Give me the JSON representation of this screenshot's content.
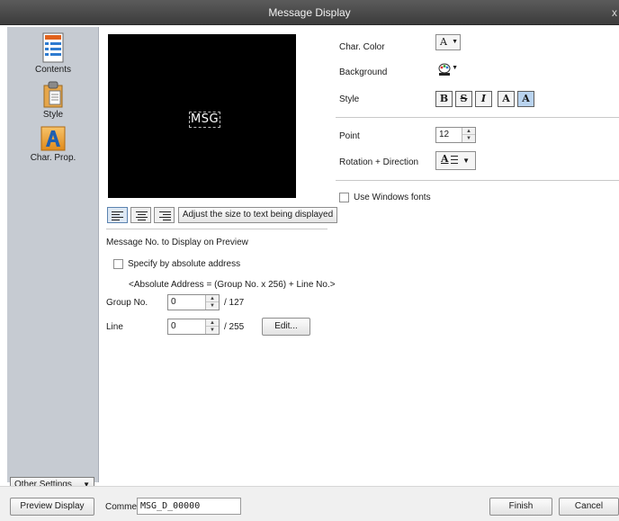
{
  "window": {
    "title": "Message Display",
    "close_glyph": "x"
  },
  "sidebar": {
    "items": [
      {
        "label": "Contents",
        "icon": "contents-icon"
      },
      {
        "label": "Style",
        "icon": "style-icon"
      },
      {
        "label": "Char. Prop.",
        "icon": "char-prop-icon"
      }
    ],
    "other_settings": "Other Settings"
  },
  "preview": {
    "message_text": "MSG"
  },
  "alignment": {
    "adjust_label": "Adjust the size to text being displayed"
  },
  "message_no": {
    "section_label": "Message No. to Display on Preview",
    "absolute_checkbox_label": "Specify by absolute address",
    "absolute_formula": "<Absolute Address = (Group No. x 256) + Line No.>",
    "group_label": "Group No.",
    "group_value": "0",
    "group_max": "/ 127",
    "line_label": "Line",
    "line_value": "0",
    "line_max": "/ 255",
    "edit_label": "Edit..."
  },
  "char_props": {
    "char_color_label": "Char. Color",
    "char_color_glyph": "A",
    "background_label": "Background",
    "style_label": "Style",
    "style_buttons": [
      "B",
      "S",
      "I",
      "A",
      "A"
    ],
    "point_label": "Point",
    "point_value": "12",
    "rotation_label": "Rotation + Direction",
    "rotation_glyph": "A",
    "windows_fonts_label": "Use Windows fonts"
  },
  "bottom": {
    "preview_button": "Preview Display",
    "comment_label": "Comme",
    "comment_value": "MSG_D_00000",
    "finish_button": "Finish",
    "cancel_button": "Cancel"
  },
  "colors": {
    "titlebar": "#4a4a4a",
    "sidebar": "#c6cbd2",
    "preview_bg": "#000000",
    "accent_blue": "#2e7bd0",
    "accent_orange": "#e0621c"
  }
}
